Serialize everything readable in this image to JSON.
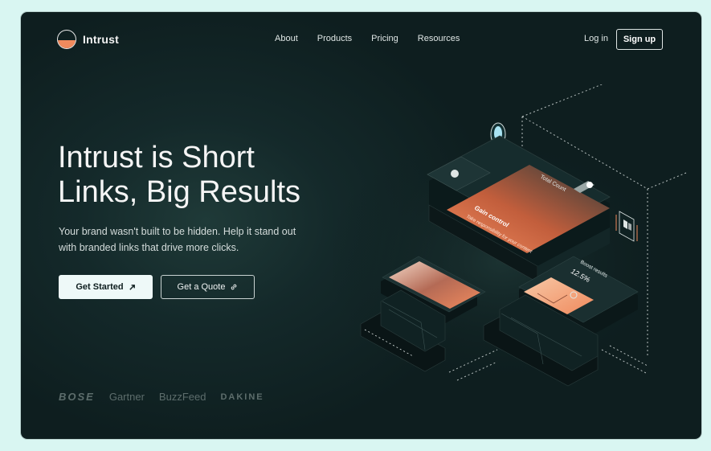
{
  "brand": {
    "name": "Intrust"
  },
  "nav": {
    "items": [
      {
        "label": "About"
      },
      {
        "label": "Products"
      },
      {
        "label": "Pricing"
      },
      {
        "label": "Resources"
      }
    ],
    "login_label": "Log in",
    "signup_label": "Sign up"
  },
  "hero": {
    "headline_line1": "Intrust is Short",
    "headline_line2": "Links, Big Results",
    "subtitle": "Your brand wasn't built to be hidden. Help it stand out with branded links that drive more clicks.",
    "primary_cta": "Get Started",
    "secondary_cta": "Get a Quote"
  },
  "illustration": {
    "card_total": "Total Count",
    "card_gain_title": "Gain control",
    "card_gain_sub": "Take responsibility for your content",
    "card_boost": "Boost results",
    "card_percent": "12.5%"
  },
  "partner_logos": [
    "BOSE",
    "Gartner",
    "BuzzFeed",
    "DAKINE"
  ],
  "colors": {
    "background": "#0e1e1f",
    "accent": "#f08a5d",
    "page_bg": "#d9f6f2"
  }
}
